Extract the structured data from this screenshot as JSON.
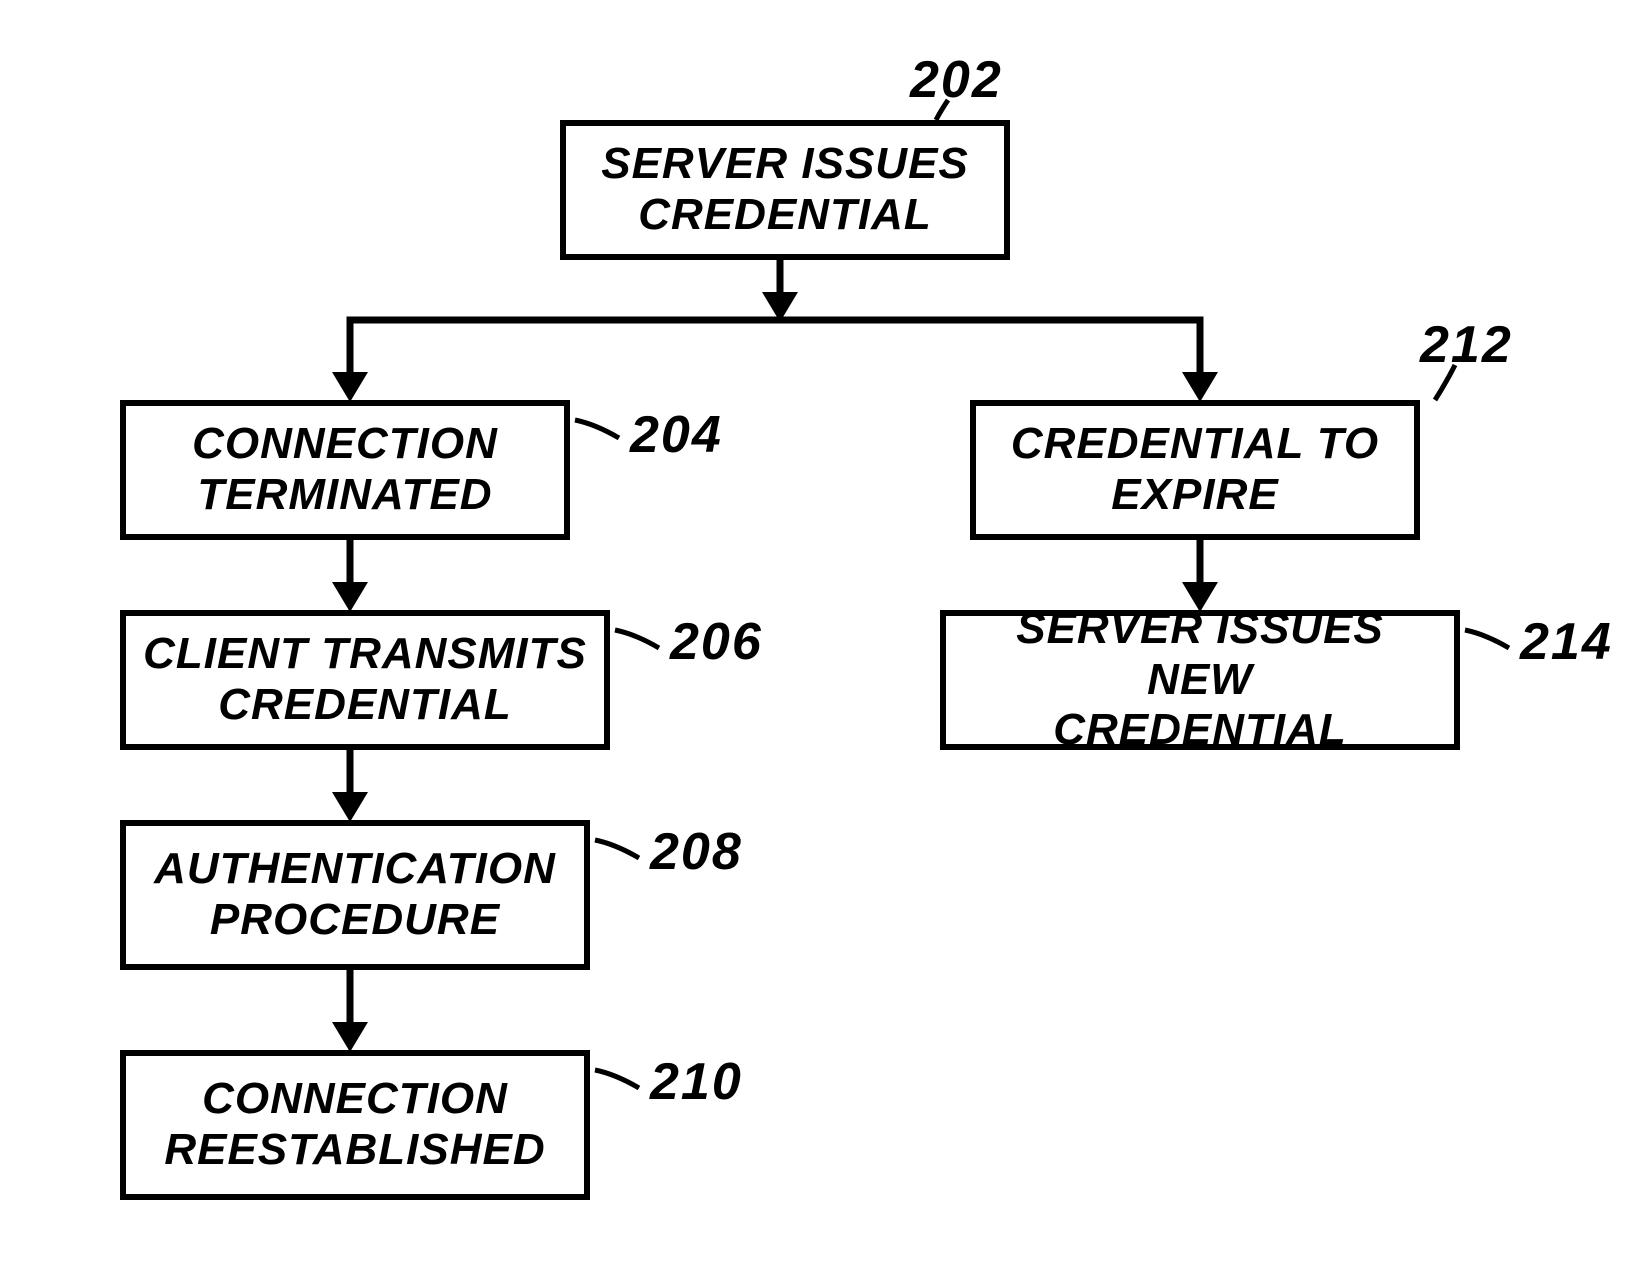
{
  "chart_data": {
    "type": "flowchart",
    "nodes": [
      {
        "id": "202",
        "label": "SERVER ISSUES\nCREDENTIAL"
      },
      {
        "id": "204",
        "label": "CONNECTION\nTERMINATED"
      },
      {
        "id": "206",
        "label": "CLIENT TRANSMITS\nCREDENTIAL"
      },
      {
        "id": "208",
        "label": "AUTHENTICATION\nPROCEDURE"
      },
      {
        "id": "210",
        "label": "CONNECTION\nREESTABLISHED"
      },
      {
        "id": "212",
        "label": "CREDENTIAL TO\nEXPIRE"
      },
      {
        "id": "214",
        "label": "SERVER ISSUES NEW\nCREDENTIAL"
      }
    ],
    "edges": [
      {
        "from": "202",
        "to": "204"
      },
      {
        "from": "202",
        "to": "212"
      },
      {
        "from": "204",
        "to": "206"
      },
      {
        "from": "206",
        "to": "208"
      },
      {
        "from": "208",
        "to": "210"
      },
      {
        "from": "212",
        "to": "214"
      }
    ]
  },
  "boxes": {
    "b202": "SERVER ISSUES\nCREDENTIAL",
    "b204": "CONNECTION\nTERMINATED",
    "b206": "CLIENT TRANSMITS\nCREDENTIAL",
    "b208": "AUTHENTICATION\nPROCEDURE",
    "b210": "CONNECTION\nREESTABLISHED",
    "b212": "CREDENTIAL TO\nEXPIRE",
    "b214": "SERVER ISSUES NEW\nCREDENTIAL"
  },
  "refs": {
    "r202": "202",
    "r204": "204",
    "r206": "206",
    "r208": "208",
    "r210": "210",
    "r212": "212",
    "r214": "214"
  }
}
